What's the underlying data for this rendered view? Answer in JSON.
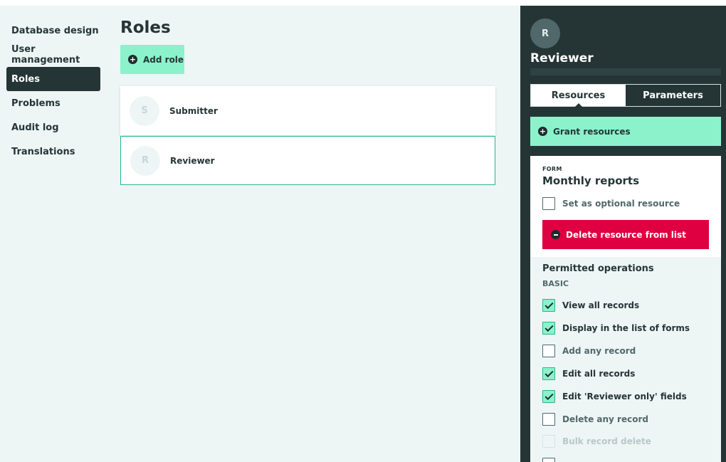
{
  "sidebar": {
    "items": [
      {
        "label": "Database design"
      },
      {
        "label": "User management"
      },
      {
        "label": "Roles",
        "active": true
      },
      {
        "label": "Problems"
      },
      {
        "label": "Audit log"
      },
      {
        "label": "Translations"
      }
    ]
  },
  "main": {
    "title": "Roles",
    "add_role_label": "Add role",
    "roles": [
      {
        "initial": "S",
        "name": "Submitter"
      },
      {
        "initial": "R",
        "name": "Reviewer",
        "selected": true
      }
    ]
  },
  "panel": {
    "avatar_initial": "R",
    "title": "Reviewer",
    "tabs": [
      {
        "label": "Resources",
        "active": true
      },
      {
        "label": "Parameters"
      }
    ],
    "grant_label": "Grant resources",
    "resource": {
      "kind": "FORM",
      "name": "Monthly reports",
      "optional_label": "Set as optional resource",
      "optional_checked": false,
      "delete_label": "Delete resource from list"
    },
    "operations": {
      "title": "Permitted operations",
      "group": "BASIC",
      "items": [
        {
          "label": "View all records",
          "checked": true
        },
        {
          "label": "Display in the list of forms",
          "checked": true
        },
        {
          "label": "Add any record",
          "checked": false
        },
        {
          "label": "Edit all records",
          "checked": true
        },
        {
          "label": "Edit 'Reviewer only' fields",
          "checked": true
        },
        {
          "label": "Delete any record",
          "checked": false
        },
        {
          "label": "Bulk record delete",
          "checked": false,
          "disabled": true
        }
      ]
    }
  },
  "colors": {
    "accent": "#8bf2cc",
    "dark": "#253536",
    "danger": "#de0040",
    "background": "#eef5f5"
  }
}
